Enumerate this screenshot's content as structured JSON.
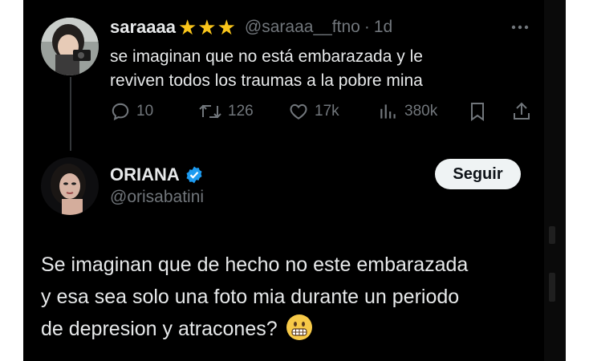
{
  "reply": {
    "display_name": "saraaaa",
    "stars": [
      "★",
      "★",
      "★"
    ],
    "handle": "@saraaa__ftno",
    "separator": "·",
    "time": "1d",
    "text_line1": "se imaginan que no está embarazada y le",
    "text_line2": "reviven todos los traumas a la pobre mina",
    "stats": {
      "replies": "10",
      "reposts": "126",
      "likes": "17k",
      "views": "380k"
    },
    "icons": [
      "reply-icon",
      "repost-icon",
      "like-icon",
      "views-icon",
      "bookmark-icon",
      "share-icon",
      "more-icon"
    ]
  },
  "main": {
    "display_name": "ORIANA",
    "handle": "@orisabatini",
    "follow_label": "Seguir",
    "text_line1": "Se imaginan que de hecho no este embarazada",
    "text_line2": "y esa sea solo una foto mia durante un periodo",
    "text_line3": "de depresion y atracones?",
    "emoji": "grimacing-face"
  },
  "colors": {
    "background": "#000000",
    "text": "#e7e9ea",
    "secondary": "#71767b",
    "verified": "#1d9bf0",
    "star": "#f9c51a",
    "button": "#eff3f4"
  }
}
